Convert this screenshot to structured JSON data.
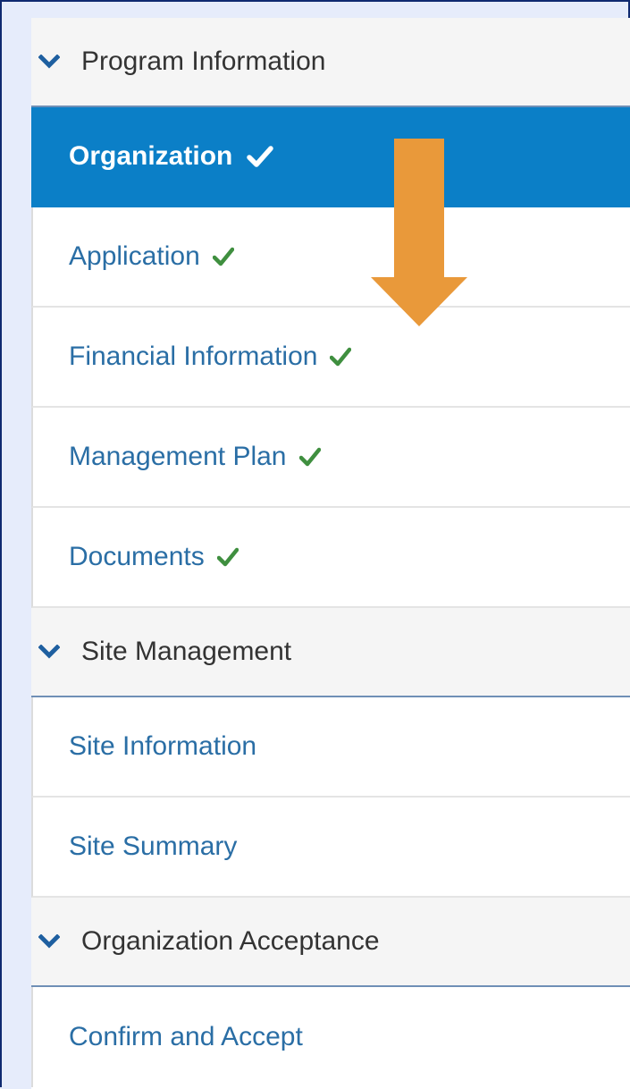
{
  "sections": [
    {
      "title": "Program Information",
      "items": [
        {
          "label": "Organization",
          "complete": true,
          "active": true
        },
        {
          "label": "Application",
          "complete": true,
          "active": false
        },
        {
          "label": "Financial Information",
          "complete": true,
          "active": false
        },
        {
          "label": "Management Plan",
          "complete": true,
          "active": false
        },
        {
          "label": "Documents",
          "complete": true,
          "active": false
        }
      ]
    },
    {
      "title": "Site Management",
      "items": [
        {
          "label": "Site Information",
          "complete": false,
          "active": false
        },
        {
          "label": "Site Summary",
          "complete": false,
          "active": false
        }
      ]
    },
    {
      "title": "Organization Acceptance",
      "items": [
        {
          "label": "Confirm and Accept",
          "complete": false,
          "active": false
        }
      ]
    }
  ],
  "icons": {
    "section_toggle": "chevron-down-icon",
    "complete": "checkmark-icon",
    "annotation": "arrow-down-icon"
  },
  "colors": {
    "active_bg": "#0b7fc7",
    "link_text": "#2a6ea5",
    "check_green": "#3f8f3f",
    "chevron": "#1e5fa0",
    "annotation_arrow": "#e9993a",
    "frame_bg": "#e6ecfb",
    "frame_border": "#0f2a70"
  }
}
